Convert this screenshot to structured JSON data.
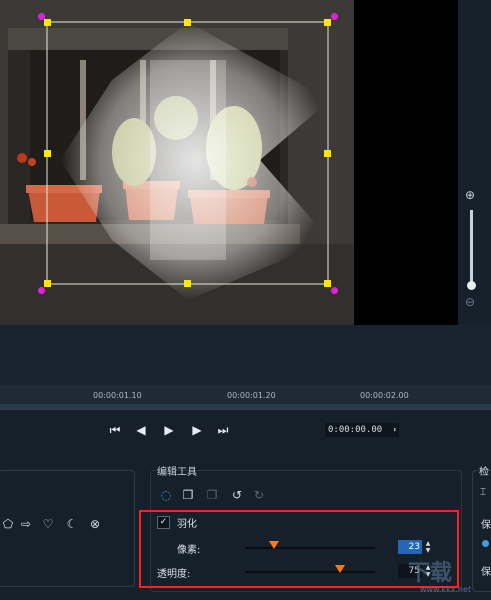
{
  "timeline": {
    "ticks": [
      "00:00:01.10",
      "00:00:01.20",
      "00:00:02.00"
    ],
    "timecode": "0:00:00.00"
  },
  "transport": {
    "icons": [
      "skip-to-start-icon",
      "step-back-icon",
      "play-icon",
      "step-forward-icon",
      "skip-to-end-icon"
    ]
  },
  "edit_tools": {
    "title": "编辑工具",
    "feather": {
      "checked": true,
      "label": "羽化"
    },
    "pixels": {
      "label": "像素:",
      "value": "23",
      "fraction": 0.23
    },
    "opacity": {
      "label": "透明度:",
      "value": "75",
      "fraction": 0.75
    }
  },
  "right_panel": {
    "label_1": "检",
    "label_2": "保",
    "label_3": "保"
  },
  "shape_icons": [
    "pentagon-icon",
    "arrow-icon",
    "heart-icon",
    "moon-icon",
    "x-circle-icon"
  ],
  "watermark": {
    "text": "下载",
    "url": "www.kkx.net"
  },
  "colors": {
    "accent": "#ff7a18",
    "highlight": "#ff1f1f",
    "handle_yellow": "#ffe800",
    "handle_magenta": "#e020e0"
  }
}
